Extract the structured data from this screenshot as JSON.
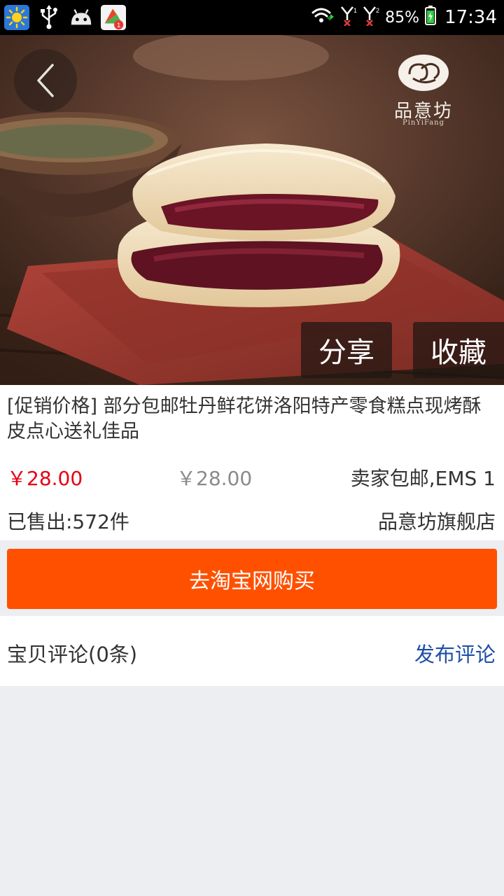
{
  "status_bar": {
    "battery": "85%",
    "time": "17:34",
    "notification_badge": "1"
  },
  "hero": {
    "brand_name": "品意坊",
    "brand_sub": "PinYiFang",
    "share_label": "分享",
    "favorite_label": "收藏"
  },
  "product": {
    "title": "[促销价格] 部分包邮牡丹鲜花饼洛阳特产零食糕点现烤酥皮点心送礼佳品",
    "price_current": "￥28.00",
    "price_original": "￥28.00",
    "shipping": "卖家包邮,EMS 1",
    "sold": "已售出:572件",
    "shop": "品意坊旗舰店"
  },
  "actions": {
    "buy_label": "去淘宝网购买"
  },
  "comments": {
    "title": "宝贝评论(0条)",
    "post_label": "发布评论"
  },
  "colors": {
    "accent": "#ff5000",
    "price_red": "#e60012",
    "link_blue": "#1d4ea8",
    "background": "#eceef1"
  }
}
